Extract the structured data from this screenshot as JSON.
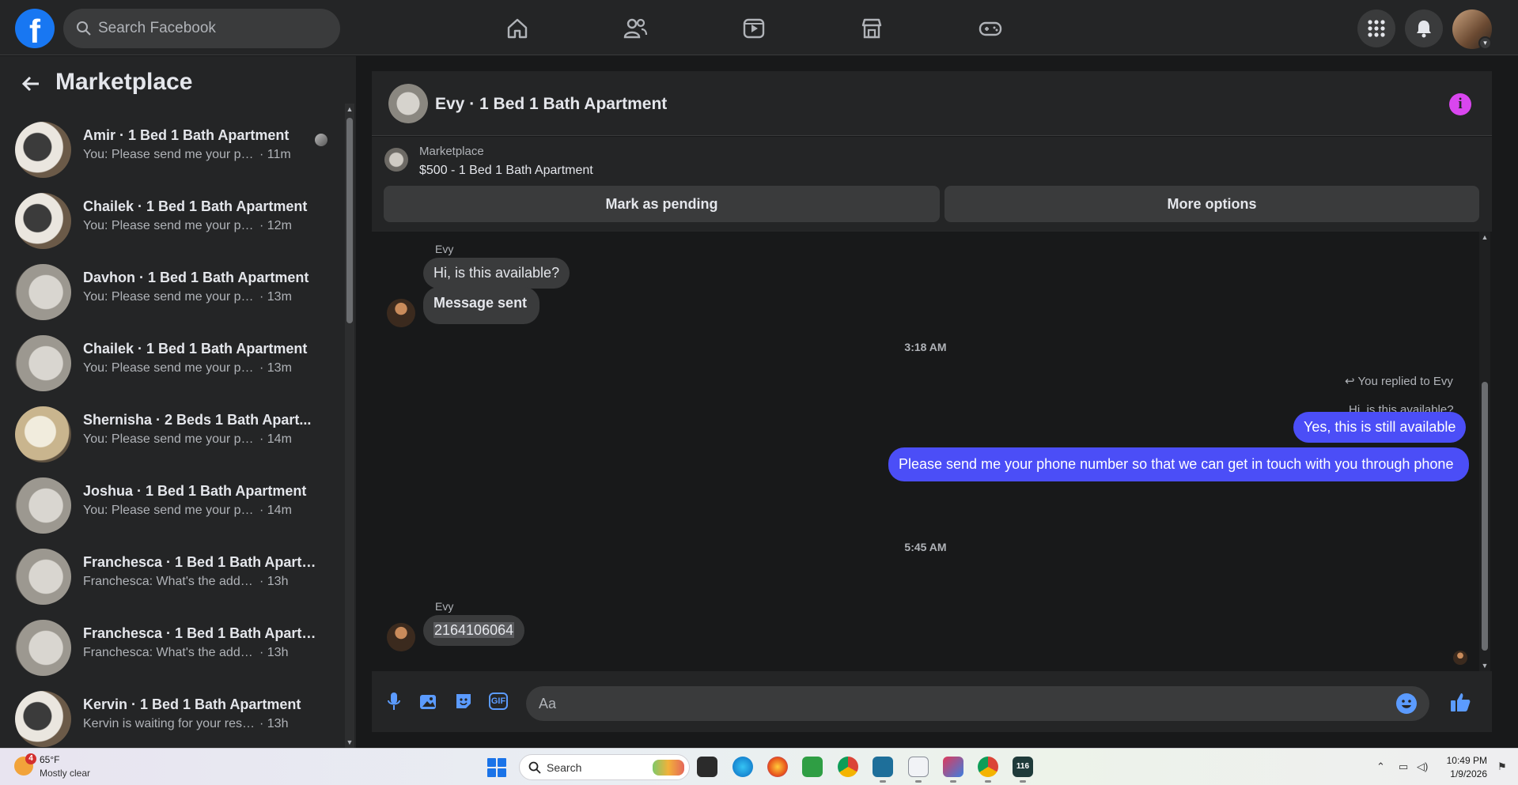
{
  "topnav": {
    "logo": "f",
    "search_placeholder": "Search Facebook",
    "nav_icons": [
      "home-icon",
      "friends-icon",
      "video-icon",
      "marketplace-icon",
      "gaming-icon"
    ],
    "right_icons": [
      "menu-grid-icon",
      "notifications-bell-icon",
      "profile-avatar"
    ]
  },
  "sidebar": {
    "title": "Marketplace",
    "conversations": [
      {
        "name": "Amir · 1 Bed 1 Bath Apartment",
        "preview": "You: Please send me your phon...",
        "time": "· 11m"
      },
      {
        "name": "Chailek · 1 Bed 1 Bath Apartment",
        "preview": "You: Please send me your phone ...",
        "time": "· 12m"
      },
      {
        "name": "Davhon · 1 Bed 1 Bath Apartment",
        "preview": "You: Please send me your phone ...",
        "time": "· 13m"
      },
      {
        "name": "Chailek · 1 Bed 1 Bath Apartment",
        "preview": "You: Please send me your phone ...",
        "time": "· 13m"
      },
      {
        "name": "Shernisha · 2 Beds 1 Bath Apart...",
        "preview": "You: Please send me your phone ...",
        "time": "· 14m"
      },
      {
        "name": "Joshua · 1 Bed 1 Bath Apartment",
        "preview": "You: Please send me your phone ...",
        "time": "· 14m"
      },
      {
        "name": "Franchesca · 1 Bed 1 Bath Apartm...",
        "preview": "Franchesca: What's the address for...",
        "time": "· 13h"
      },
      {
        "name": "Franchesca · 1 Bed 1 Bath Apartm...",
        "preview": "Franchesca: What's the address for...",
        "time": "· 13h"
      },
      {
        "name": "Kervin · 1 Bed 1 Bath Apartment",
        "preview": "Kervin is waiting for your response.",
        "time": "· 13h"
      }
    ]
  },
  "chat": {
    "title": "Evy · 1 Bed 1 Bath Apartment",
    "listing": {
      "label": "Marketplace",
      "title": "$500 - 1 Bed 1 Bath Apartment",
      "mark_pending": "Mark as pending",
      "more_options": "More options"
    },
    "messages": {
      "sender1": "Evy",
      "msg1": "Hi, is this available?",
      "msg2": "Message sent",
      "time1": "3:18 AM",
      "replied_note": "You replied to Evy",
      "quoted": "Hi, is this available?",
      "out1": "Yes, this is still available",
      "out2": "Please send me your phone  number so that we can get in touch with you through phone",
      "time2": "5:45 AM",
      "sender2": "Evy",
      "msg3": "2164106064"
    },
    "composer_placeholder": "Aa"
  },
  "taskbar": {
    "weather_badge": "4",
    "weather_temp": "65°F",
    "weather_desc": "Mostly clear",
    "search_label": "Search",
    "clock_time": "10:49 PM",
    "clock_date": "1/9/2026",
    "app_badge": "116"
  },
  "colors": {
    "brand": "#1877f2",
    "outgoing_bubble": "#4b4ef7",
    "info_accent": "#d946ef",
    "background": "#18191a",
    "surface": "#242526"
  }
}
